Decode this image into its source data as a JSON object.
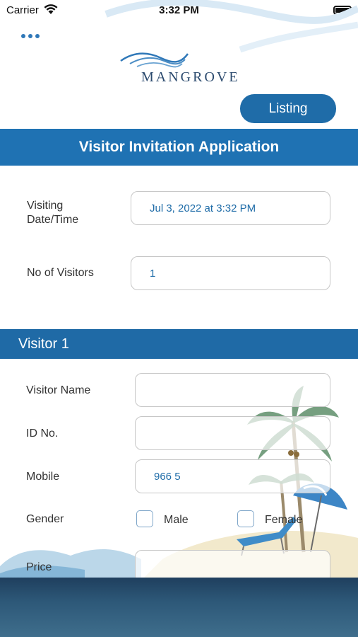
{
  "status_bar": {
    "carrier": "Carrier",
    "time": "3:32 PM"
  },
  "header": {
    "logo_text": "MANGROVE",
    "listing_label": "Listing"
  },
  "title": "Visitor Invitation Application",
  "visit": {
    "date_label": "Visiting\nDate/Time",
    "date_value": "Jul 3, 2022 at 3:32 PM",
    "visitors_label": "No of Visitors",
    "visitors_value": "1"
  },
  "visitor_section": {
    "title": "Visitor 1",
    "name_label": "Visitor Name",
    "name_value": "",
    "id_label": "ID No.",
    "id_value": "",
    "mobile_label": "Mobile",
    "mobile_value": "966 5",
    "gender_label": "Gender",
    "gender_options": [
      "Male",
      "Female"
    ],
    "price_label": "Price"
  },
  "colors": {
    "primary": "#1f72b3",
    "accent_text": "#1f6ca8"
  },
  "icons": [
    "more-icon",
    "wifi-icon",
    "battery-icon",
    "logo-wave-icon"
  ]
}
